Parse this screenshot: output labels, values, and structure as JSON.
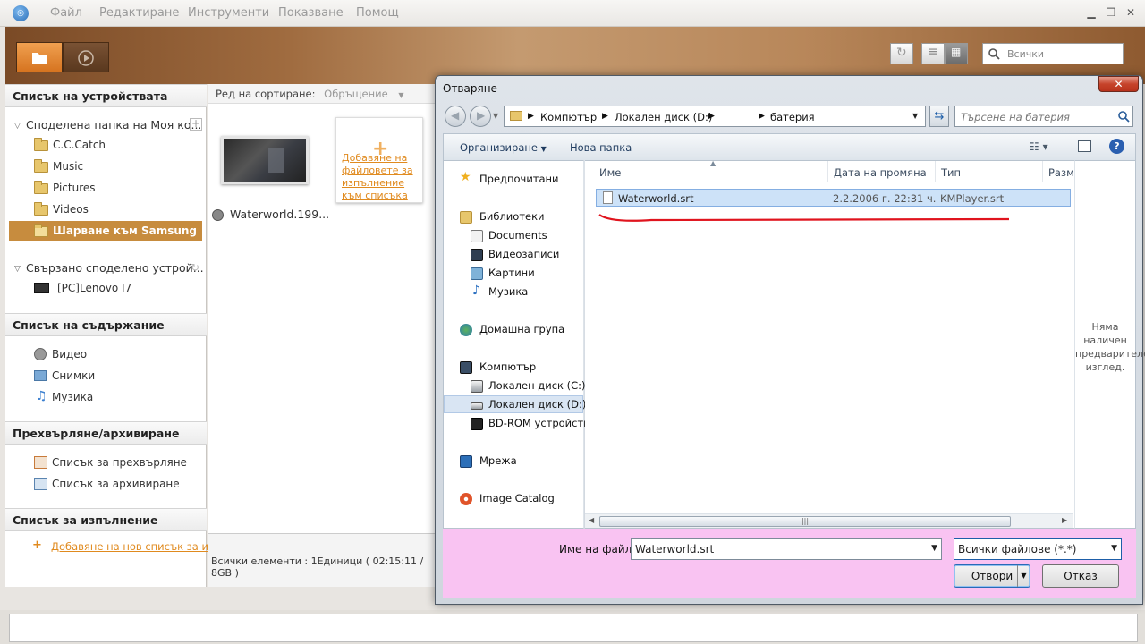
{
  "menu": [
    "Файл",
    "Редактиране",
    "Инструменти",
    "Показване",
    "Помощ"
  ],
  "toolbar": {
    "search_placeholder": "Всички"
  },
  "sections": {
    "devices": "Списък на устройствата",
    "content": "Списък на съдържание",
    "convert": "Прехвърляне/архивиране",
    "playlist": "Списък за изпълнение"
  },
  "devices": {
    "shared_folder": "Споделена папка на Моя ко...",
    "folders": [
      "C.C.Catch",
      "Music",
      "Pictures",
      "Videos"
    ],
    "selected": "Шарване към Samsung",
    "connected": "Свързано споделено устрой...",
    "pc": "[PC]Lenovo I7"
  },
  "content_items": [
    "Видео",
    "Снимки",
    "Музика"
  ],
  "convert_items": [
    "Списък за прехвърляне",
    "Списък за архивиране"
  ],
  "playlist": {
    "add_link": "Добавяне на нов списък за изп..."
  },
  "center": {
    "sort_label": "Ред на сортиране:",
    "sort_value": "Обръщение",
    "add_card_text": "Добавяне на файловете за изпълнение към списъка",
    "item_title": "Waterworld.199...",
    "status": "Всички елементи : 1Единици ( 02:15:11 / 8GB )"
  },
  "dialog": {
    "title": "Отваряне",
    "close": "✕",
    "breadcrumb": [
      "Компютър",
      "Локален диск (D:)",
      "батерия"
    ],
    "search_placeholder": "Търсене на батерия",
    "organize": "Организиране",
    "new_folder": "Нова папка",
    "nav": {
      "favorites": "Предпочитани",
      "libraries": "Библиотеки",
      "lib_items": [
        "Documents",
        "Видеозаписи",
        "Картини",
        "Музика"
      ],
      "homegroup": "Домашна група",
      "computer": "Компютър",
      "drives": [
        "Локален диск (C:)",
        "Локален диск (D:)",
        "BD-ROM устройств"
      ],
      "network": "Мрежа",
      "catalog": "Image Catalog"
    },
    "columns": [
      "Име",
      "Дата на промяна",
      "Тип",
      "Разм"
    ],
    "file": {
      "name": "Waterworld.srt",
      "date": "2.2.2006 г. 22:31 ч.",
      "type": "KMPlayer.srt"
    },
    "preview": "Няма наличен предварителен изглед.",
    "filename_label": "Име на файл:",
    "filename_value": "Waterworld.srt",
    "filetype_value": "Всички файлове (*.*)",
    "open_button": "Отвори",
    "cancel_button": "Отказ"
  }
}
